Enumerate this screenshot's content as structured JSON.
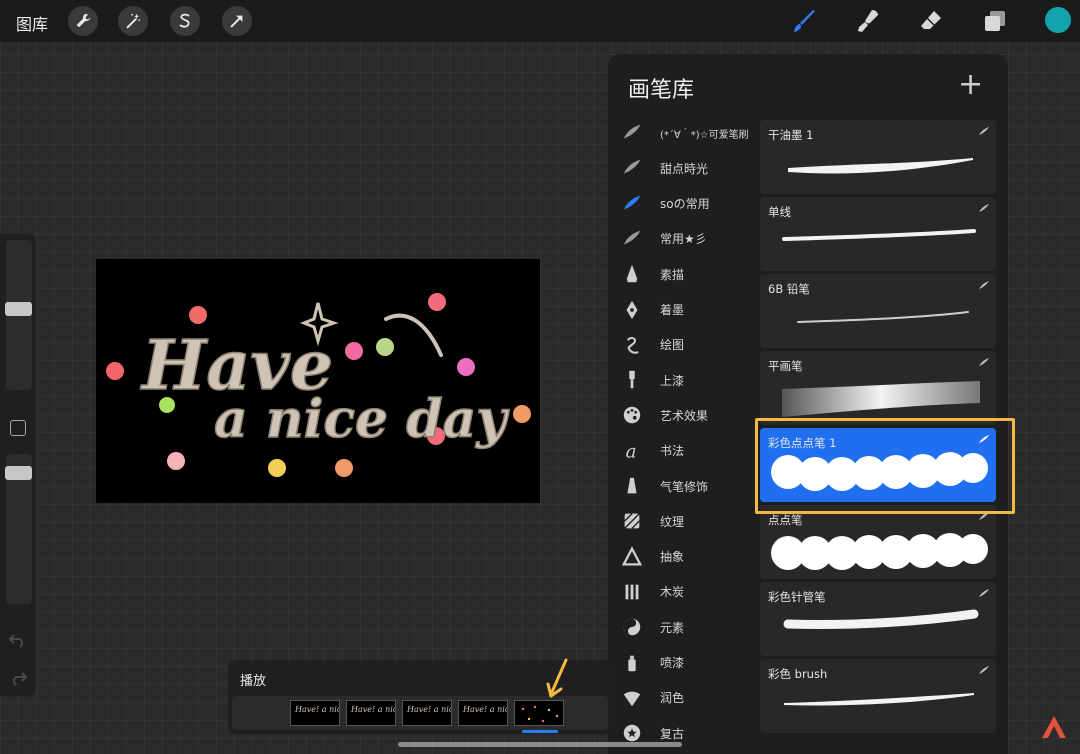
{
  "topbar": {
    "gallery_label": "图库",
    "accent_color": "#12a3ad"
  },
  "tools": {
    "left": [
      "wrench-icon",
      "magic-wand-icon",
      "selection-icon",
      "transform-arrow-icon"
    ],
    "right": [
      "brush-icon",
      "smudge-icon",
      "eraser-icon",
      "layers-icon"
    ],
    "active_tool_color": "#2f7df6"
  },
  "artwork": {
    "line1": "Have",
    "line2": "a nice day",
    "letter_color": "#cfc3b5"
  },
  "library": {
    "title": "画笔库",
    "add_label": "+",
    "categories": [
      {
        "label": "(*´∀｀*)☆可爱笔刷",
        "icon": "brush-stroke-icon"
      },
      {
        "label": "甜点時光",
        "icon": "brush-stroke-icon"
      },
      {
        "label": "soの常用",
        "icon": "brush-stroke-icon",
        "active": true
      },
      {
        "label": "常用★彡",
        "icon": "brush-stroke-icon"
      },
      {
        "label": "素描",
        "icon": "pencil-tip-icon"
      },
      {
        "label": "着墨",
        "icon": "ink-nib-icon"
      },
      {
        "label": "绘图",
        "icon": "swirl-icon"
      },
      {
        "label": "上漆",
        "icon": "paint-brush-icon"
      },
      {
        "label": "艺术效果",
        "icon": "palette-icon"
      },
      {
        "label": "书法",
        "icon": "calligraphy-icon"
      },
      {
        "label": "气笔修饰",
        "icon": "airbrush-icon"
      },
      {
        "label": "纹理",
        "icon": "texture-icon"
      },
      {
        "label": "抽象",
        "icon": "triangle-icon"
      },
      {
        "label": "木炭",
        "icon": "charcoal-icon"
      },
      {
        "label": "元素",
        "icon": "yin-yang-icon"
      },
      {
        "label": "喷漆",
        "icon": "spray-can-icon"
      },
      {
        "label": "润色",
        "icon": "shell-icon"
      },
      {
        "label": "复古",
        "icon": "star-circle-icon"
      }
    ],
    "brushes": [
      {
        "name": "干油墨 1"
      },
      {
        "name": "单线"
      },
      {
        "name": "6B 铅笔"
      },
      {
        "name": "平画笔"
      },
      {
        "name": "彩色点点笔 1",
        "selected": true
      },
      {
        "name": "点点笔"
      },
      {
        "name": "彩色针管笔"
      },
      {
        "name": "彩色 brush"
      }
    ],
    "selected_color": "#1f6ff0",
    "highlight_color": "#f5b942"
  },
  "animation": {
    "label": "播放",
    "frames": [
      {
        "text": "Have! a nice day"
      },
      {
        "text": "Have! a nice day"
      },
      {
        "text": "Have! a nice day"
      },
      {
        "text": "Have! a nice day"
      },
      {
        "text": ""
      }
    ]
  }
}
